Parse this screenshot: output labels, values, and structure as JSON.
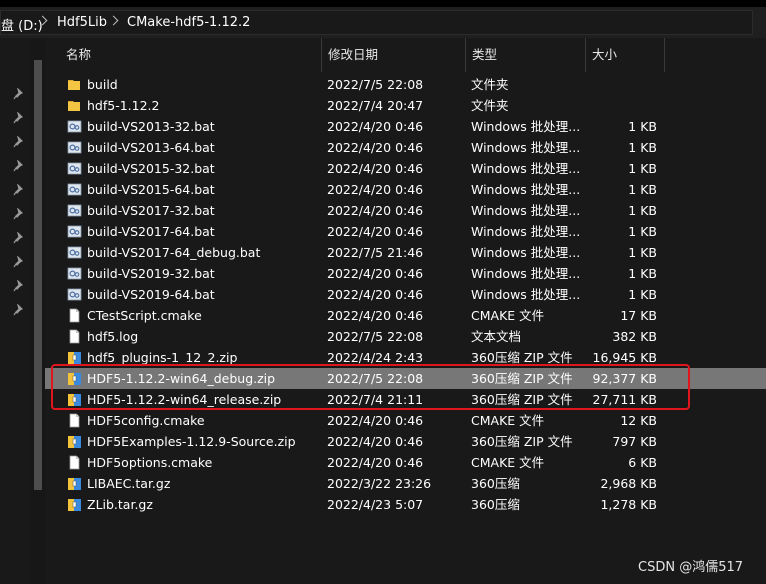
{
  "breadcrumbs": [
    "盘 (D:)",
    "Hdf5Lib",
    "CMake-hdf5-1.12.2"
  ],
  "columns": {
    "name": "名称",
    "date": "修改日期",
    "type": "类型",
    "size": "大小"
  },
  "files": [
    {
      "name": "build",
      "date": "2022/7/5 22:08",
      "type": "文件夹",
      "size": "",
      "icon": "folder-icon"
    },
    {
      "name": "hdf5-1.12.2",
      "date": "2022/7/4 20:47",
      "type": "文件夹",
      "size": "",
      "icon": "folder-icon"
    },
    {
      "name": "build-VS2013-32.bat",
      "date": "2022/4/20 0:46",
      "type": "Windows 批处理...",
      "size": "1 KB",
      "icon": "batch-file-icon"
    },
    {
      "name": "build-VS2013-64.bat",
      "date": "2022/4/20 0:46",
      "type": "Windows 批处理...",
      "size": "1 KB",
      "icon": "batch-file-icon"
    },
    {
      "name": "build-VS2015-32.bat",
      "date": "2022/4/20 0:46",
      "type": "Windows 批处理...",
      "size": "1 KB",
      "icon": "batch-file-icon"
    },
    {
      "name": "build-VS2015-64.bat",
      "date": "2022/4/20 0:46",
      "type": "Windows 批处理...",
      "size": "1 KB",
      "icon": "batch-file-icon"
    },
    {
      "name": "build-VS2017-32.bat",
      "date": "2022/4/20 0:46",
      "type": "Windows 批处理...",
      "size": "1 KB",
      "icon": "batch-file-icon"
    },
    {
      "name": "build-VS2017-64.bat",
      "date": "2022/4/20 0:46",
      "type": "Windows 批处理...",
      "size": "1 KB",
      "icon": "batch-file-icon"
    },
    {
      "name": "build-VS2017-64_debug.bat",
      "date": "2022/7/5 21:46",
      "type": "Windows 批处理...",
      "size": "1 KB",
      "icon": "batch-file-icon"
    },
    {
      "name": "build-VS2019-32.bat",
      "date": "2022/4/20 0:46",
      "type": "Windows 批处理...",
      "size": "1 KB",
      "icon": "batch-file-icon"
    },
    {
      "name": "build-VS2019-64.bat",
      "date": "2022/4/20 0:46",
      "type": "Windows 批处理...",
      "size": "1 KB",
      "icon": "batch-file-icon"
    },
    {
      "name": "CTestScript.cmake",
      "date": "2022/4/20 0:46",
      "type": "CMAKE 文件",
      "size": "17 KB",
      "icon": "document-icon"
    },
    {
      "name": "hdf5.log",
      "date": "2022/7/5 22:08",
      "type": "文本文档",
      "size": "382 KB",
      "icon": "document-icon"
    },
    {
      "name": "hdf5_plugins-1_12_2.zip",
      "date": "2022/4/24 2:43",
      "type": "360压缩 ZIP 文件",
      "size": "16,945 KB",
      "icon": "zip-archive-icon"
    },
    {
      "name": "HDF5-1.12.2-win64_debug.zip",
      "date": "2022/7/5 22:08",
      "type": "360压缩 ZIP 文件",
      "size": "92,377 KB",
      "icon": "zip-archive-icon",
      "selected": true
    },
    {
      "name": "HDF5-1.12.2-win64_release.zip",
      "date": "2022/7/4 21:11",
      "type": "360压缩 ZIP 文件",
      "size": "27,711 KB",
      "icon": "zip-archive-icon"
    },
    {
      "name": "HDF5config.cmake",
      "date": "2022/4/20 0:46",
      "type": "CMAKE 文件",
      "size": "12 KB",
      "icon": "document-icon"
    },
    {
      "name": "HDF5Examples-1.12.9-Source.zip",
      "date": "2022/4/20 0:46",
      "type": "360压缩 ZIP 文件",
      "size": "797 KB",
      "icon": "zip-archive-icon"
    },
    {
      "name": "HDF5options.cmake",
      "date": "2022/4/20 0:46",
      "type": "CMAKE 文件",
      "size": "6 KB",
      "icon": "document-icon"
    },
    {
      "name": "LIBAEC.tar.gz",
      "date": "2022/3/22 23:26",
      "type": "360压缩",
      "size": "2,968 KB",
      "icon": "zip-archive-icon"
    },
    {
      "name": "ZLib.tar.gz",
      "date": "2022/4/23 5:07",
      "type": "360压缩",
      "size": "1,278 KB",
      "icon": "zip-archive-icon"
    }
  ],
  "watermark": "CSDN @鸿儒517",
  "colors": {
    "background": "#191919",
    "selection": "#777777",
    "highlight_box": "#e0161f",
    "folder": "#f4c542"
  }
}
